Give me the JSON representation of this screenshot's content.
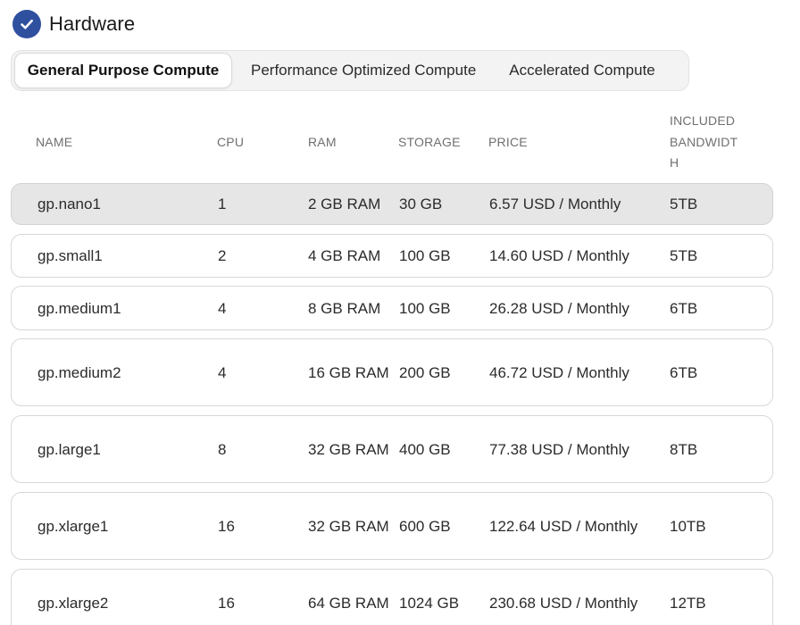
{
  "section": {
    "title": "Hardware",
    "icon": "check-circle-icon"
  },
  "tabs": [
    {
      "label": "General Purpose Compute",
      "selected": true
    },
    {
      "label": "Performance Optimized Compute",
      "selected": false
    },
    {
      "label": "Accelerated Compute",
      "selected": false
    }
  ],
  "table": {
    "columns": [
      "NAME",
      "CPU",
      "RAM",
      "STORAGE",
      "PRICE",
      "INCLUDED BANDWIDTH"
    ],
    "rows": [
      {
        "name": "gp.nano1",
        "cpu": "1",
        "ram": "2 GB RAM",
        "storage": "30 GB",
        "price": "6.57 USD / Monthly",
        "bandwidth": "5TB",
        "selected": true
      },
      {
        "name": "gp.small1",
        "cpu": "2",
        "ram": "4 GB RAM",
        "storage": "100 GB",
        "price": "14.60 USD / Monthly",
        "bandwidth": "5TB"
      },
      {
        "name": "gp.medium1",
        "cpu": "4",
        "ram": "8 GB RAM",
        "storage": "100 GB",
        "price": "26.28 USD / Monthly",
        "bandwidth": "6TB"
      },
      {
        "name": "gp.medium2",
        "cpu": "4",
        "ram": "16 GB RAM",
        "storage": "200 GB",
        "price": "46.72 USD / Monthly",
        "bandwidth": "6TB"
      },
      {
        "name": "gp.large1",
        "cpu": "8",
        "ram": "32 GB RAM",
        "storage": "400 GB",
        "price": "77.38 USD / Monthly",
        "bandwidth": "8TB"
      },
      {
        "name": "gp.xlarge1",
        "cpu": "16",
        "ram": "32 GB RAM",
        "storage": "600 GB",
        "price": "122.64 USD / Monthly",
        "bandwidth": "10TB"
      },
      {
        "name": "gp.xlarge2",
        "cpu": "16",
        "ram": "64 GB RAM",
        "storage": "1024 GB",
        "price": "230.68 USD / Monthly",
        "bandwidth": "12TB"
      }
    ]
  },
  "colors": {
    "accent": "#2f4f9f",
    "selected_row": "#e6e6e6"
  }
}
